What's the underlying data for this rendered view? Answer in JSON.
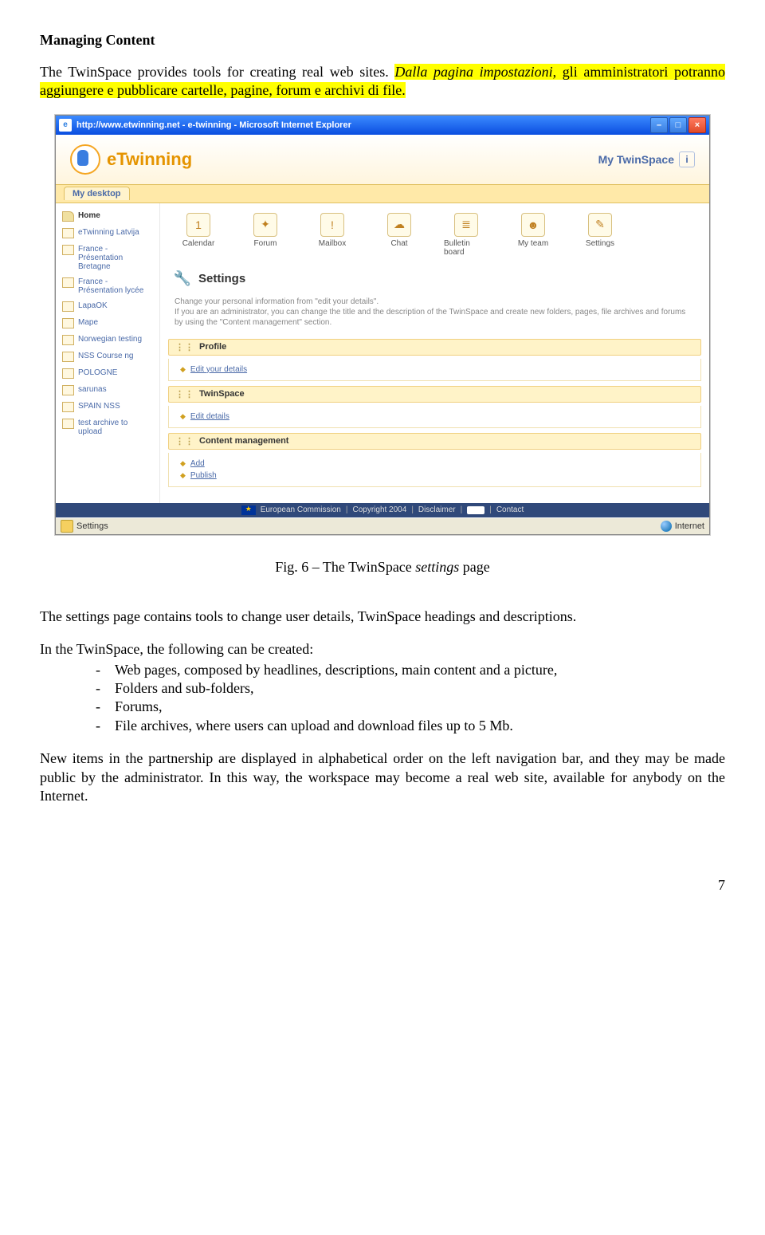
{
  "doc": {
    "heading": "Managing Content",
    "para1_a": "The TwinSpace provides tools for creating real web sites. ",
    "para1_b_hi_it": "Dalla pagina impostazioni",
    "para1_c_hi": ", gli amministratori potranno aggiungere e pubblicare cartelle, pagine, forum e archivi di  file.",
    "caption_a": "Fig. 6 – The TwinSpace ",
    "caption_it": "settings",
    "caption_b": " page",
    "para2": "The settings page contains tools to change user details, TwinSpace headings and descriptions.",
    "para3_intro": "In the TwinSpace, the following can be created:",
    "bullets": [
      "Web pages, composed by headlines, descriptions, main content and a picture,",
      "Folders and sub-folders,",
      "Forums,",
      "File archives, where users can upload and download files up to 5 Mb."
    ],
    "para4": "New items in the partnership are displayed in alphabetical order on the left navigation bar, and they may be made public by the administrator. In this way, the workspace may become a real web site, available for anybody on the Internet.",
    "page_number": "7"
  },
  "shot": {
    "title": "http://www.etwinning.net - e-twinning - Microsoft Internet Explorer",
    "winbtn_min": "–",
    "winbtn_max": "□",
    "winbtn_close": "×",
    "logo": "eTwinning",
    "mytwinspace": "My TwinSpace",
    "mydesktop": "My desktop",
    "tools": [
      {
        "label": "Calendar",
        "glyph": "1"
      },
      {
        "label": "Forum",
        "glyph": "✦"
      },
      {
        "label": "Mailbox",
        "glyph": "!"
      },
      {
        "label": "Chat",
        "glyph": "☁"
      },
      {
        "label": "Bulletin board",
        "glyph": "≣"
      },
      {
        "label": "My team",
        "glyph": "☻"
      },
      {
        "label": "Settings",
        "glyph": "✎"
      }
    ],
    "sidebar": [
      {
        "label": "Home",
        "bold": true,
        "icon": "home"
      },
      {
        "label": "eTwinning Latvija",
        "icon": "folder"
      },
      {
        "label": "France - Présentation Bretagne",
        "icon": "folder"
      },
      {
        "label": "France - Présentation lycée",
        "icon": "folder"
      },
      {
        "label": "LapaOK",
        "icon": "page"
      },
      {
        "label": "Mape",
        "icon": "folder"
      },
      {
        "label": "Norwegian testing",
        "icon": "folder"
      },
      {
        "label": "NSS Course ng",
        "icon": "folder"
      },
      {
        "label": "POLOGNE",
        "icon": "folder"
      },
      {
        "label": "sarunas",
        "icon": "chat"
      },
      {
        "label": "SPAIN NSS",
        "icon": "folder"
      },
      {
        "label": "test archive to upload",
        "icon": "file"
      }
    ],
    "settings_title": "Settings",
    "desc_line1": "Change your personal information from \"edit your details\".",
    "desc_line2": "If you are an administrator, you can change the title and the description of the TwinSpace and create new folders, pages, file archives and forums by using the \"Content management\" section.",
    "sections": {
      "profile": {
        "title": "Profile",
        "links": [
          "Edit your details"
        ]
      },
      "twinspace": {
        "title": "TwinSpace",
        "links": [
          "Edit details"
        ]
      },
      "content_mgmt": {
        "title": "Content management",
        "links": [
          "Add",
          "Publish"
        ]
      }
    },
    "footer": {
      "ec": "European Commission",
      "copyright": "Copyright 2004",
      "disclaimer": "Disclaimer",
      "contact": "Contact"
    },
    "status_left": "Settings",
    "status_right": "Internet"
  }
}
